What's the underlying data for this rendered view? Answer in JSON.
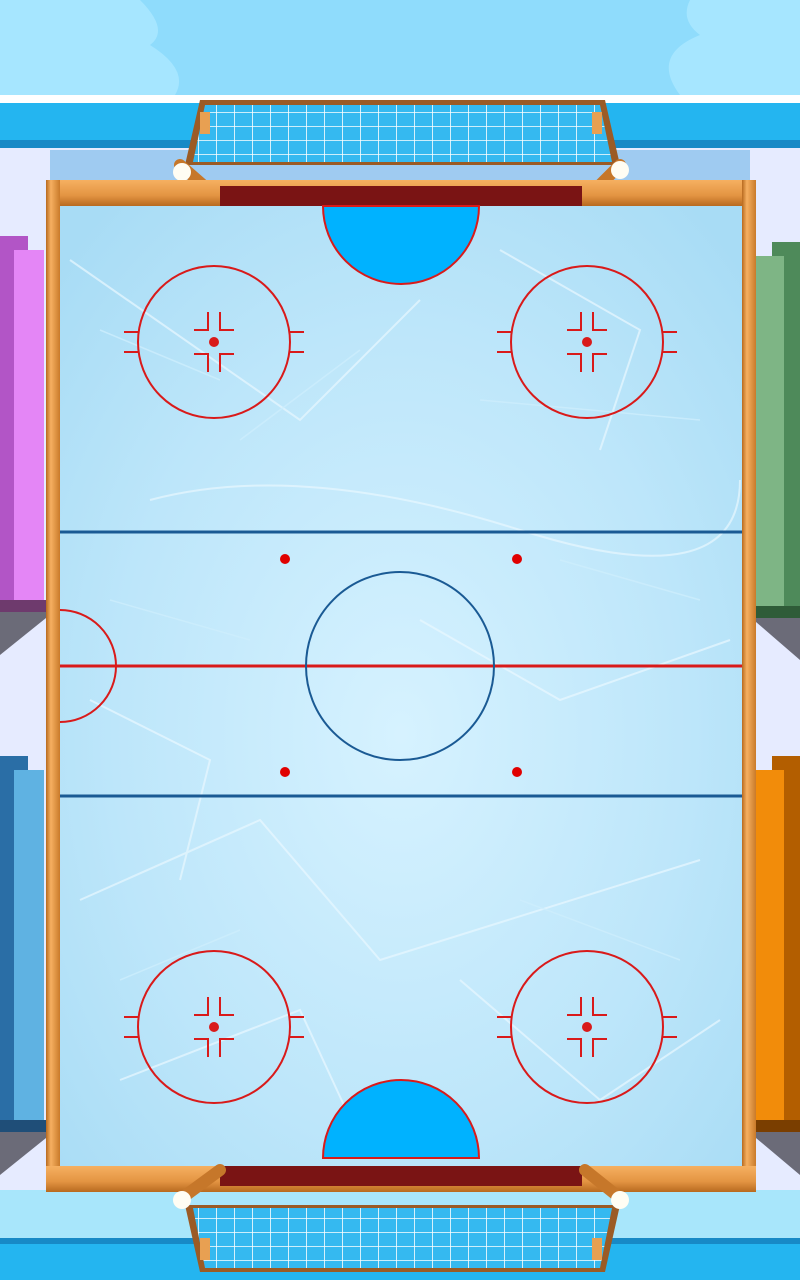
{
  "game": {
    "scene": "air-hockey-ice-rink",
    "colors": {
      "sky_top": "#9fe4ff",
      "sky_bottom": "#7fd8fb",
      "rail_blue": "#2ab3ee",
      "rail_blue_dark": "#1d8dc7",
      "wood": "#f0a24a",
      "wood_dark": "#b86a1f",
      "goal_mouth": "#7a1414",
      "ice": "#bfe8fb",
      "ice_light": "#d8f3ff",
      "crease": "#00b2ff",
      "red_line": "#d91a1a",
      "blue_line": "#1a5a94",
      "paddle_pink": "#e58bf5",
      "paddle_green": "#7eb585",
      "paddle_blue": "#5fb2e2",
      "paddle_orange": "#f28c0a"
    },
    "side_blocks": [
      {
        "name": "pink-side-block",
        "color": "paddle_pink",
        "side": "left"
      },
      {
        "name": "green-side-block",
        "color": "paddle_green",
        "side": "right"
      },
      {
        "name": "blue-side-block",
        "color": "paddle_blue",
        "side": "left"
      },
      {
        "name": "orange-side-block",
        "color": "paddle_orange",
        "side": "right"
      }
    ],
    "goals": [
      "top-goal",
      "bottom-goal"
    ],
    "faceoff_circles": [
      "top-left",
      "top-right",
      "bottom-left",
      "bottom-right"
    ],
    "neutral_dots": 4
  }
}
